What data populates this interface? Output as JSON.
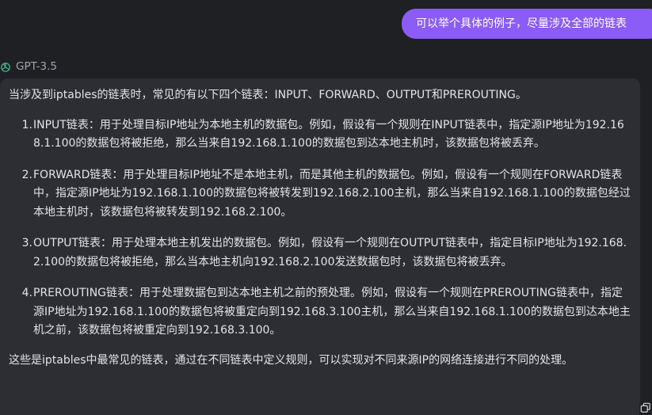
{
  "user_message": "可以举个具体的例子，尽量涉及全部的链表",
  "model": {
    "name": "GPT-3.5",
    "icon": "openai-logo-icon"
  },
  "answer": {
    "intro": "当涉及到iptables的链表时，常见的有以下四个链表：INPUT、FORWARD、OUTPUT和PREROUTING。",
    "items": [
      {
        "number": "1.",
        "text": "INPUT链表：用于处理目标IP地址为本地主机的数据包。例如，假设有一个规则在INPUT链表中，指定源IP地址为192.168.1.100的数据包将被拒绝，那么当来自192.168.1.100的数据包到达本地主机时，该数据包将被丢弃。"
      },
      {
        "number": "2.",
        "text": "FORWARD链表：用于处理目标IP地址不是本地主机，而是其他主机的数据包。例如，假设有一个规则在FORWARD链表中，指定源IP地址为192.168.1.100的数据包将被转发到192.168.2.100主机，那么当来自192.168.1.100的数据包经过本地主机时，该数据包将被转发到192.168.2.100。"
      },
      {
        "number": "3.",
        "text": "OUTPUT链表：用于处理本地主机发出的数据包。例如，假设有一个规则在OUTPUT链表中，指定目标IP地址为192.168.2.100的数据包将被拒绝，那么当本地主机向192.168.2.100发送数据包时，该数据包将被丢弃。"
      },
      {
        "number": "4.",
        "text": "PREROUTING链表：用于处理数据包到达本地主机之前的预处理。例如，假设有一个规则在PREROUTING链表中，指定源IP地址为192.168.1.100的数据包将被重定向到192.168.3.100主机，那么当来自192.168.1.100的数据包到达本地主机之前，该数据包将被重定向到192.168.3.100。"
      }
    ],
    "outro": "这些是iptables中最常见的链表，通过在不同链表中定义规则，可以实现对不同来源IP的网络连接进行不同的处理。"
  },
  "colors": {
    "background": "#1f2024",
    "user_bubble": "#8b5cf6",
    "card": "#2d2e33",
    "text": "#e4e4e7",
    "muted": "#a3a3aa"
  },
  "icons": {
    "copy": "copy-icon"
  }
}
